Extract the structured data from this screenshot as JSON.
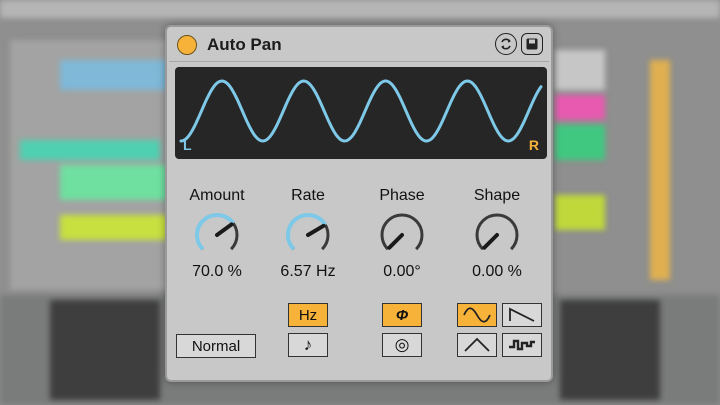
{
  "device": {
    "title": "Auto Pan",
    "display": {
      "left_label": "L",
      "right_label": "R"
    },
    "knobs": [
      {
        "name": "Amount",
        "value": "70.0 %",
        "fraction": 0.7
      },
      {
        "name": "Rate",
        "value": "6.57 Hz",
        "fraction": 0.72
      },
      {
        "name": "Phase",
        "value": "0.00°",
        "fraction": 0.0
      },
      {
        "name": "Shape",
        "value": "0.00 %",
        "fraction": 0.0
      }
    ],
    "rate_mode": {
      "hz_label": "Hz",
      "sync_label": "♪",
      "selected": "Hz"
    },
    "phase_mode": {
      "phase_label": "Φ",
      "spin_label": "◎",
      "selected": "phase"
    },
    "mode_button": "Normal",
    "waveforms": [
      "sine",
      "saw-down",
      "triangle",
      "random"
    ],
    "selected_waveform": "sine",
    "colors": {
      "accent": "#f7b23a",
      "wave": "#7ec8e8",
      "display_bg": "#262626",
      "panel": "#c8c8c8"
    }
  }
}
